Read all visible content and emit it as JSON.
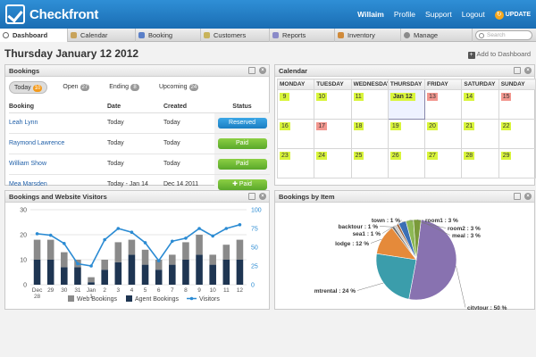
{
  "app": {
    "brand": "Checkfront",
    "user": "Willaim",
    "profile": "Profile",
    "support": "Support",
    "logout": "Logout",
    "update": "UPDATE"
  },
  "tabs": [
    {
      "label": "Dashboard",
      "color": "#888"
    },
    {
      "label": "Calendar",
      "color": "#c8a35a"
    },
    {
      "label": "Booking",
      "color": "#5a7fc8"
    },
    {
      "label": "Customers",
      "color": "#c8b35a"
    },
    {
      "label": "Reports",
      "color": "#8a8ac8"
    },
    {
      "label": "Inventory",
      "color": "#d08a3a"
    },
    {
      "label": "Manage",
      "color": "#8a8a8a"
    }
  ],
  "search": {
    "placeholder": "Search"
  },
  "page": {
    "title": "Thursday January 12 2012",
    "add_to_dashboard": "Add to Dashboard"
  },
  "bookings": {
    "title": "Bookings",
    "filters": [
      {
        "label": "Today",
        "count": "10"
      },
      {
        "label": "Open",
        "count": "27"
      },
      {
        "label": "Ending",
        "count": "8"
      },
      {
        "label": "Upcoming",
        "count": "24"
      }
    ],
    "columns": [
      "Booking",
      "Date",
      "Created",
      "Status"
    ],
    "rows": [
      {
        "name": "Leah Lynn",
        "date": "Today",
        "created": "Today",
        "status": "Reserved",
        "type": "reserved"
      },
      {
        "name": "Raymond Lawrence",
        "date": "Today",
        "created": "Today",
        "status": "Paid",
        "type": "paid"
      },
      {
        "name": "William Show",
        "date": "Today",
        "created": "Today",
        "status": "Paid",
        "type": "paid"
      },
      {
        "name": "Mea Marsden",
        "date": "Today - Jan 14",
        "created": "Dec 14 2011",
        "status": "Paid",
        "type": "paid"
      }
    ]
  },
  "calendar": {
    "title": "Calendar",
    "days": [
      "MONDAY",
      "TUESDAY",
      "WEDNESDAY",
      "THURSDAY",
      "FRIDAY",
      "SATURDAY",
      "SUNDAY"
    ],
    "weeks": [
      [
        {
          "d": "9",
          "c": "green"
        },
        {
          "d": "10",
          "c": "green"
        },
        {
          "d": "11",
          "c": "green"
        },
        {
          "d": "Jan 12",
          "c": "today"
        },
        {
          "d": "13",
          "c": "red"
        },
        {
          "d": "14",
          "c": "green"
        },
        {
          "d": "15",
          "c": "red"
        }
      ],
      [
        {
          "d": "16",
          "c": "green"
        },
        {
          "d": "17",
          "c": "red"
        },
        {
          "d": "18",
          "c": "green"
        },
        {
          "d": "19",
          "c": "green"
        },
        {
          "d": "20",
          "c": "green"
        },
        {
          "d": "21",
          "c": "green"
        },
        {
          "d": "22",
          "c": "green"
        }
      ],
      [
        {
          "d": "23",
          "c": "green"
        },
        {
          "d": "24",
          "c": "green"
        },
        {
          "d": "25",
          "c": "green"
        },
        {
          "d": "26",
          "c": "green"
        },
        {
          "d": "27",
          "c": "green"
        },
        {
          "d": "28",
          "c": "green"
        },
        {
          "d": "29",
          "c": "green"
        }
      ]
    ]
  },
  "visitors_chart": {
    "title": "Bookings and Website Visitors"
  },
  "items_chart": {
    "title": "Bookings by Item"
  },
  "chart_data": [
    {
      "type": "bar",
      "stacked": true,
      "title": "Bookings and Website Visitors",
      "categories": [
        "Dec 28",
        "29",
        "30",
        "31",
        "Jan 1",
        "2",
        "3",
        "4",
        "5",
        "6",
        "7",
        "8",
        "9",
        "10",
        "11",
        "12"
      ],
      "category_lines": [
        [
          "Dec",
          "28"
        ],
        [
          "29"
        ],
        [
          "30"
        ],
        [
          "31"
        ],
        [
          "Jan",
          "1"
        ],
        [
          "2"
        ],
        [
          "3"
        ],
        [
          "4"
        ],
        [
          "5"
        ],
        [
          "6"
        ],
        [
          "7"
        ],
        [
          "8"
        ],
        [
          "9"
        ],
        [
          "10"
        ],
        [
          "11"
        ],
        [
          "12"
        ]
      ],
      "ylim": [
        0,
        30
      ],
      "yticks": [
        0,
        10,
        20,
        30
      ],
      "y2lim": [
        0,
        100
      ],
      "y2ticks": [
        0,
        25,
        50,
        75,
        100
      ],
      "series": [
        {
          "name": "Web Bookings",
          "color": "#8a8a8a",
          "values": [
            8,
            8,
            6,
            3,
            2,
            4,
            8,
            6,
            6,
            4,
            4,
            7,
            8,
            4,
            6,
            8
          ]
        },
        {
          "name": "Agent Bookings",
          "color": "#1e3552",
          "values": [
            10,
            10,
            7,
            7,
            1,
            6,
            9,
            12,
            8,
            6,
            8,
            10,
            12,
            8,
            10,
            10
          ]
        },
        {
          "name": "Visitors",
          "color": "#2b8bd3",
          "type": "line",
          "axis": "right",
          "values": [
            68,
            66,
            55,
            28,
            25,
            60,
            75,
            70,
            56,
            32,
            58,
            62,
            75,
            65,
            75,
            80
          ]
        }
      ],
      "legend": "bottom"
    },
    {
      "type": "pie",
      "title": "Bookings by Item",
      "slices": [
        {
          "label": "citytour : 50 %",
          "value": 50,
          "color": "#8872b0"
        },
        {
          "label": "mtrental : 24 %",
          "value": 24,
          "color": "#3b9dab"
        },
        {
          "label": "lodge : 12 %",
          "value": 12,
          "color": "#e58a3a"
        },
        {
          "label": "backtour : 1 %",
          "value": 1,
          "color": "#6d6d6d"
        },
        {
          "label": "sea1 : 1 %",
          "value": 1,
          "color": "#c4c4c4"
        },
        {
          "label": "town : 1 %",
          "value": 1,
          "color": "#a06840"
        },
        {
          "label": "room1 : 3 %",
          "value": 3,
          "color": "#3a6fb5"
        },
        {
          "label": "room2 : 3 %",
          "value": 3,
          "color": "#8db855"
        },
        {
          "label": "meal : 3 %",
          "value": 3,
          "color": "#7a9a3a"
        }
      ]
    }
  ]
}
